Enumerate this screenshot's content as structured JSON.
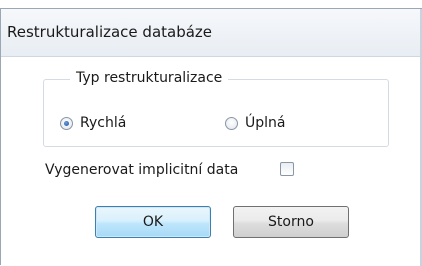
{
  "dialog": {
    "title": "Restrukturalizace databáze",
    "group": {
      "legend": "Typ restrukturalizace",
      "options": [
        {
          "label": "Rychlá",
          "checked": true
        },
        {
          "label": "Úplná",
          "checked": false
        }
      ]
    },
    "checkbox": {
      "label": "Vygenerovat implicitní data",
      "checked": false
    },
    "buttons": {
      "ok": "OK",
      "cancel": "Storno"
    }
  }
}
